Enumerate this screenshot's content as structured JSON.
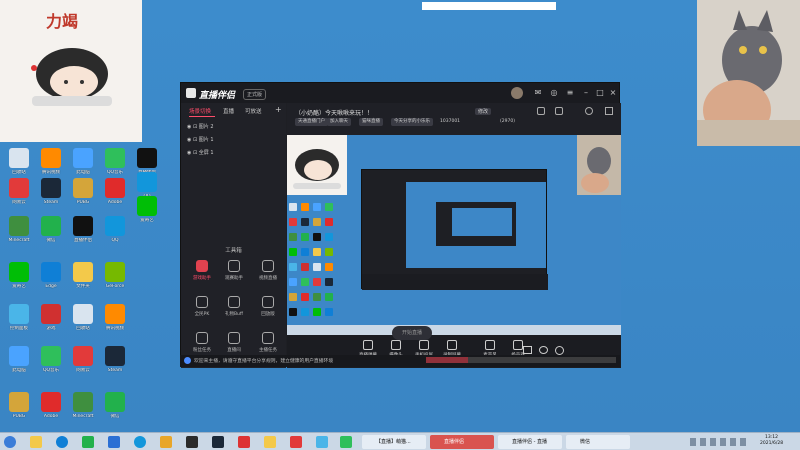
{
  "desktop_icons": [
    {
      "label": "回收站",
      "color": "#d9e4ef"
    },
    {
      "label": "腾讯视频",
      "color": "#ff8a00"
    },
    {
      "label": "此电脑",
      "color": "#4aa3ff"
    },
    {
      "label": "QQ音乐",
      "color": "#2fbf5b"
    },
    {
      "label": "网易云",
      "color": "#e23a3a"
    },
    {
      "label": "Steam",
      "color": "#1b2838"
    },
    {
      "label": "PUBG",
      "color": "#d4a53a"
    },
    {
      "label": "Adobe",
      "color": "#e02b2b"
    },
    {
      "label": "Minecraft",
      "color": "#3f8f3f"
    },
    {
      "label": "微信",
      "color": "#22b14c"
    },
    {
      "label": "直播伴侣",
      "color": "#111111"
    },
    {
      "label": "QQ",
      "color": "#1296db"
    },
    {
      "label": "爱奇艺",
      "color": "#00be06"
    },
    {
      "label": "Edge",
      "color": "#0f7fd6"
    },
    {
      "label": "文件夹",
      "color": "#f3c94a"
    },
    {
      "label": "GeForce",
      "color": "#76b900"
    },
    {
      "label": "控制面板",
      "color": "#4ab5e8"
    },
    {
      "label": "游戏",
      "color": "#d03030"
    }
  ],
  "window": {
    "app_name": "直播伴侣",
    "version_badge": "正式版",
    "scenes_tab": "场景切换",
    "tab_2": "直播",
    "tab_3": "可放送",
    "add": "+",
    "sources": [
      "图片 2",
      "图片 1",
      "全屏 1"
    ],
    "tools_title": "工具箱",
    "tools": [
      {
        "label": "游戏助手"
      },
      {
        "label": "观赛助手"
      },
      {
        "label": "视频直播"
      },
      {
        "label": "全民PK"
      },
      {
        "label": "礼物Buff"
      },
      {
        "label": "回放版"
      },
      {
        "label": "粉丝任务"
      },
      {
        "label": "直播间"
      },
      {
        "label": "主播任务"
      }
    ],
    "room_title": "（小奶酪）今天啾啾来玩！！",
    "room_tag": "修改",
    "chips": [
      "天通直播门户",
      "加入聊天",
      "猫咪直播",
      "今天分享的小乐乐",
      "1037001",
      "(2970)"
    ],
    "bottom_items": [
      {
        "label": "直播弹幕"
      },
      {
        "label": "摄像头"
      },
      {
        "label": "手机投屏"
      },
      {
        "label": "录制屏幕"
      },
      {
        "label": "麦克风"
      },
      {
        "label": "扬声器"
      }
    ],
    "start_live": "开始直播",
    "notice": "欢迎来主播，请遵守直播平台分享规则，建立健康的用户直播环境"
  },
  "taskbar": {
    "tasks": [
      {
        "label": "【直播】萌猫...",
        "active": false
      },
      {
        "label": "直播伴侣",
        "active": true
      },
      {
        "label": "直播伴侣 - 直播",
        "active": false
      },
      {
        "label": "微信",
        "active": false
      }
    ],
    "time": "13:12",
    "date": "2021/6/28"
  },
  "stickers": {
    "top_left": "力竭"
  }
}
